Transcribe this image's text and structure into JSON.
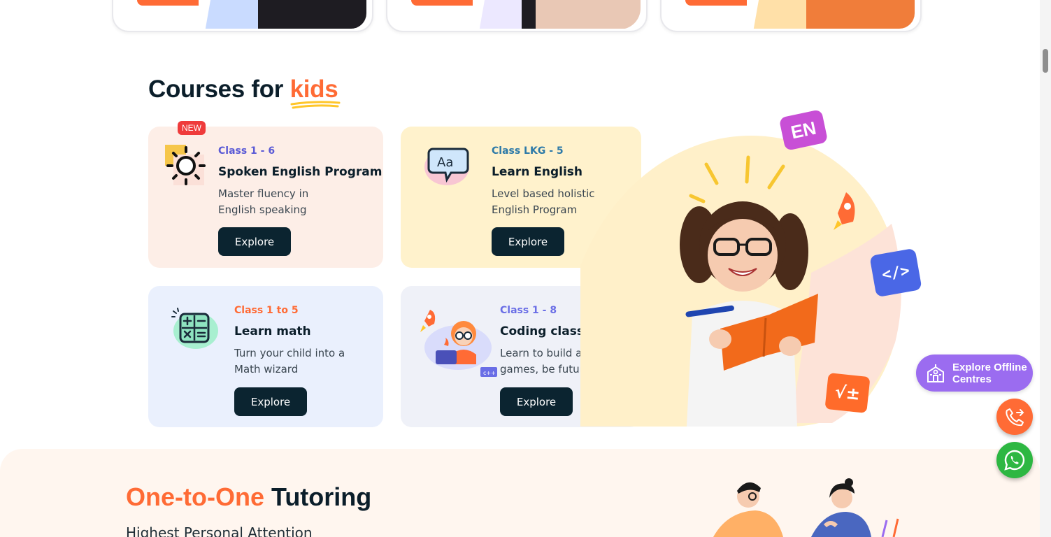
{
  "section": {
    "heading_prefix": "Courses for",
    "heading_accent": "kids"
  },
  "courses": [
    {
      "badge": "NEW",
      "class_range": "Class 1 - 6",
      "title": "Spoken English Program",
      "desc_line1": "Master fluency in",
      "desc_line2": "English speaking",
      "button": "Explore",
      "icon": "sun-icon",
      "class_color": "#5b5bd6",
      "bg": "#fdeee7"
    },
    {
      "class_range": "Class LKG - 5",
      "title": "Learn English",
      "desc_line1": "Level based holistic",
      "desc_line2": "English Program",
      "button": "Explore",
      "icon": "aa-speech-icon",
      "class_color": "#2e7aa8",
      "bg": "#fff2cc"
    },
    {
      "class_range": "Class 1 to 5",
      "title": "Learn math",
      "desc_line1": "Turn your child into a",
      "desc_line2": "Math wizard",
      "button": "Explore",
      "icon": "calculator-icon",
      "class_color": "#ff6b35",
      "bg": "#eaf0fd"
    },
    {
      "class_range": "Class 1 - 8",
      "title": "Coding classes",
      "desc_line1": "Learn to build apps and",
      "desc_line2": "games, be future ready",
      "button": "Explore",
      "icon": "coding-kid-icon",
      "class_color": "#6a6ee6",
      "bg": "#eff1f8"
    }
  ],
  "hero": {
    "en_badge": "EN",
    "code_badge": "</>",
    "math_badge": "√±"
  },
  "widgets": {
    "offline_line1": "Explore Offline",
    "offline_line2": "Centres"
  },
  "tutoring": {
    "title_accent": "One-to-One",
    "title_rest": "Tutoring",
    "subtitle": "Highest Personal Attention"
  },
  "colors": {
    "accent": "#ff6b35",
    "dark": "#0b2430",
    "purple": "#9b6cf0",
    "whatsapp": "#2db742"
  }
}
